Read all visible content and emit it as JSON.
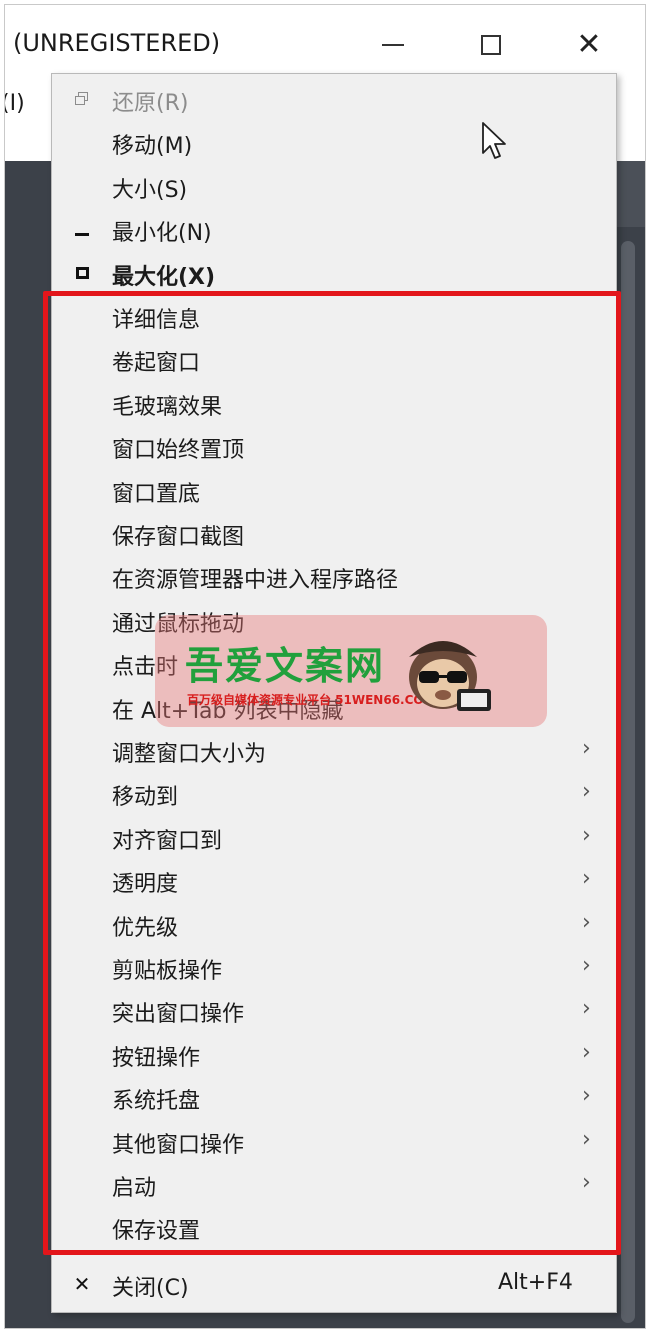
{
  "window": {
    "title": "(UNREGISTERED)",
    "menu_bar_partial": "(I)",
    "controls": {
      "minimize": "minimize-icon",
      "maximize": "maximize-icon",
      "close": "close-icon"
    }
  },
  "context_menu": {
    "items": [
      {
        "label": "还原(R)",
        "icon": "restore-icon",
        "disabled": true
      },
      {
        "label": "移动(M)"
      },
      {
        "label": "大小(S)"
      },
      {
        "label": "最小化(N)",
        "icon": "minimize-icon"
      },
      {
        "label": "最大化(X)",
        "icon": "maximize-icon",
        "bold": true
      },
      {
        "label": "详细信息"
      },
      {
        "label": "卷起窗口"
      },
      {
        "label": "毛玻璃效果"
      },
      {
        "label": "窗口始终置顶"
      },
      {
        "label": "窗口置底"
      },
      {
        "label": "保存窗口截图"
      },
      {
        "label": "在资源管理器中进入程序路径"
      },
      {
        "label": "通过鼠标拖动"
      },
      {
        "label": "点击时"
      },
      {
        "label": "在 Alt+Tab 列表中隐藏"
      },
      {
        "label": "调整窗口大小为",
        "submenu": true
      },
      {
        "label": "移动到",
        "submenu": true
      },
      {
        "label": "对齐窗口到",
        "submenu": true
      },
      {
        "label": "透明度",
        "submenu": true
      },
      {
        "label": "优先级",
        "submenu": true
      },
      {
        "label": "剪贴板操作",
        "submenu": true
      },
      {
        "label": "突出窗口操作",
        "submenu": true
      },
      {
        "label": "按钮操作",
        "submenu": true
      },
      {
        "label": "系统托盘",
        "submenu": true
      },
      {
        "label": "其他窗口操作",
        "submenu": true
      },
      {
        "label": "启动",
        "submenu": true
      },
      {
        "label": "保存设置"
      },
      {
        "label": "关闭(C)",
        "icon": "close-icon",
        "shortcut": "Alt+F4"
      }
    ],
    "submenu_arrow": "›"
  },
  "highlight_color": "#e3161b",
  "watermark": {
    "title": "吾爱文案网",
    "subtitle": "百万级自媒体资源专业平台 51WEN66.COM"
  }
}
